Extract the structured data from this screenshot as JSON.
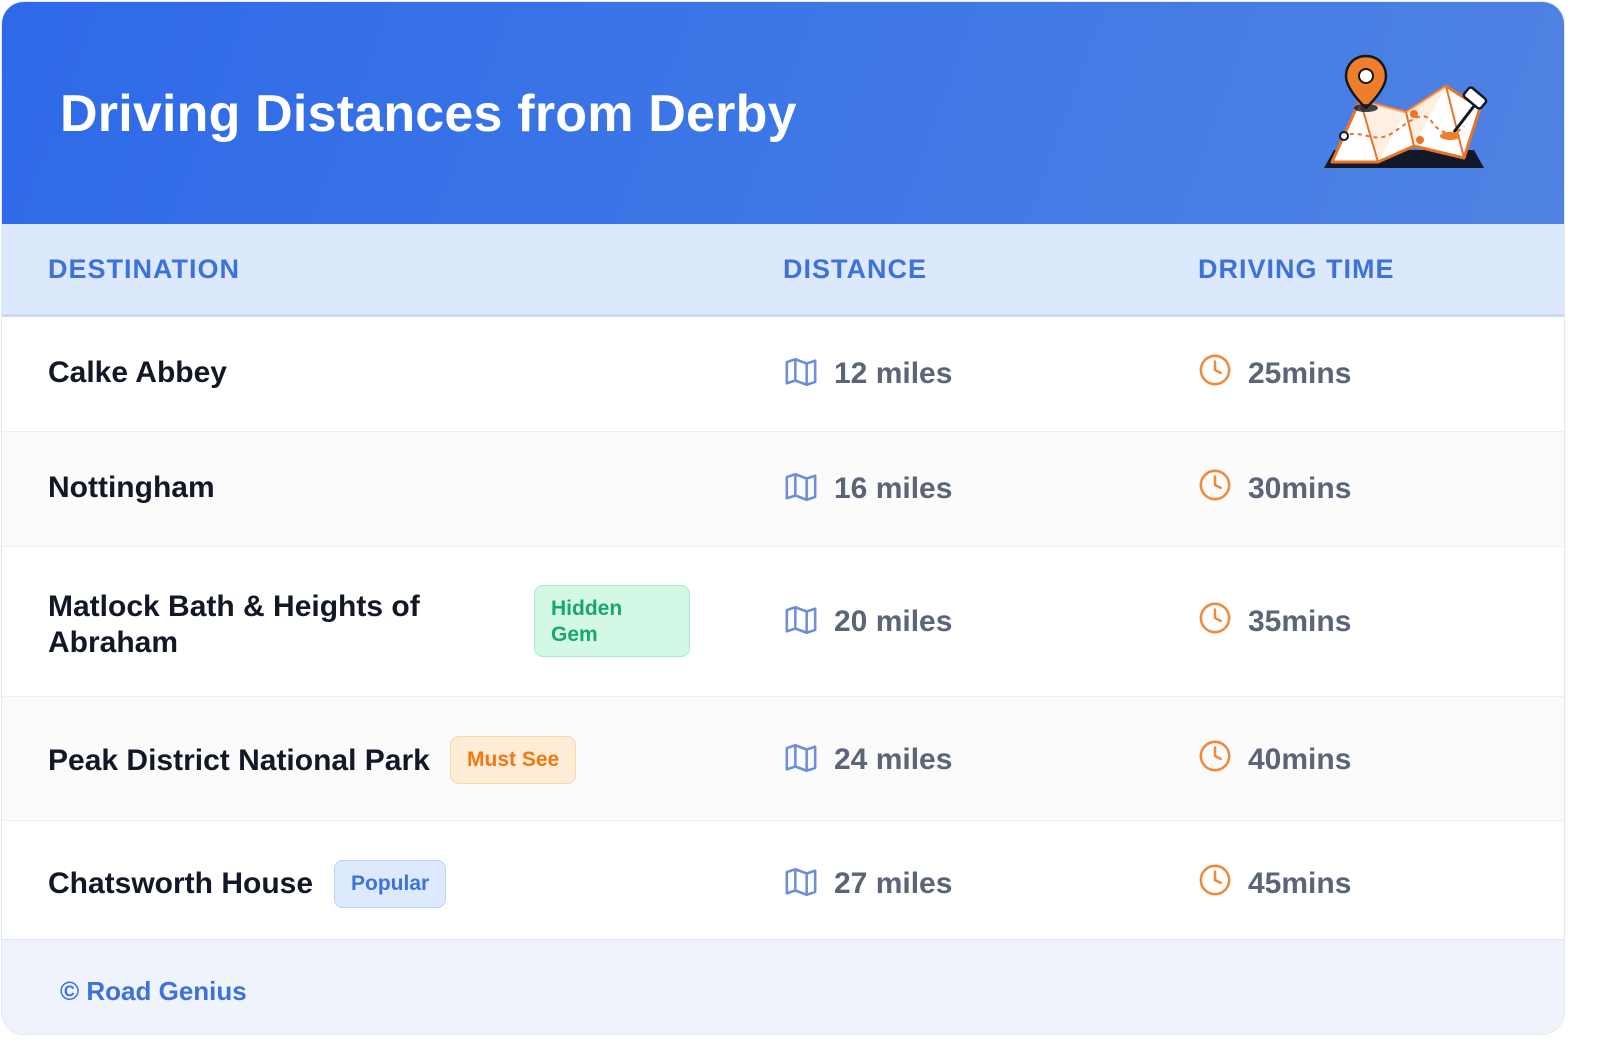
{
  "header": {
    "title": "Driving Distances from Derby"
  },
  "table": {
    "columns": [
      "DESTINATION",
      "DISTANCE",
      "DRIVING TIME"
    ],
    "rows": [
      {
        "destination": "Calke Abbey",
        "badge": "",
        "distance": "12 miles",
        "time": "25mins"
      },
      {
        "destination": "Nottingham",
        "badge": "",
        "distance": "16 miles",
        "time": "30mins"
      },
      {
        "destination_line1": "Matlock Bath & Heights of",
        "destination_line2": "Abraham",
        "badge_line1": "Hidden",
        "badge_line2": "Gem",
        "distance": "20 miles",
        "time": "35mins"
      },
      {
        "destination": "Peak District National Park",
        "badge": "Must See",
        "distance": "24 miles",
        "time": "40mins"
      },
      {
        "destination": "Chatsworth House",
        "badge": "Popular",
        "distance": "27 miles",
        "time": "45mins"
      }
    ],
    "icons": {
      "distance": "map-icon",
      "time": "clock-icon"
    }
  },
  "footer": {
    "text": "© Road Genius"
  },
  "colors": {
    "header_bg": "#2e69e8",
    "accent": "#3f72d8",
    "icon_orange": "#ef8a3c",
    "icon_blue": "#6e8fd6"
  }
}
